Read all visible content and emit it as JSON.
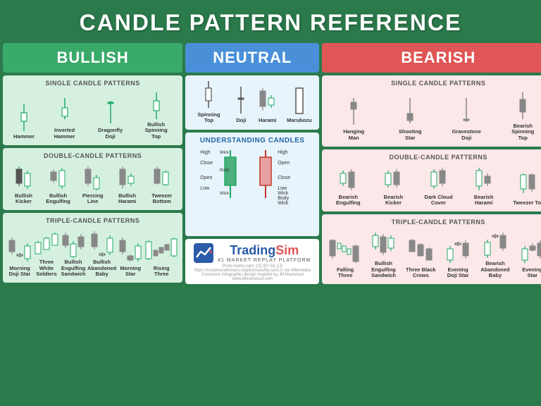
{
  "header": {
    "title": "CANDLE PATTERN REFERENCE"
  },
  "sections": {
    "bullish_label": "BULLISH",
    "neutral_label": "NEUTRAL",
    "bearish_label": "BEARISH"
  },
  "bullish_single": {
    "title": "SINGLE CANDLE PATTERNS",
    "patterns": [
      {
        "label": "Hammer"
      },
      {
        "label": "Inverted Hammer"
      },
      {
        "label": "Dragonfly Doji"
      },
      {
        "label": "Bullish Spinning Top"
      }
    ]
  },
  "bullish_double": {
    "title": "DOUBLE-CANDLE PATTERNS",
    "patterns": [
      {
        "label": "Bullish Kicker"
      },
      {
        "label": "Bullish Engulfing"
      },
      {
        "label": "Piercing Line"
      },
      {
        "label": "Bullish Harami"
      },
      {
        "label": "Tweezer Bottom"
      }
    ]
  },
  "bullish_triple": {
    "title": "TRIPLE-CANDLE PATTERNS",
    "patterns": [
      {
        "label": "Morning Doji Star"
      },
      {
        "label": "Three White Soldiers"
      },
      {
        "label": "Bullish Engulfing Sandwich"
      },
      {
        "label": "Bullish Abandoned Baby"
      },
      {
        "label": "Morning Star"
      },
      {
        "label": "Rising Three"
      }
    ]
  },
  "neutral_single": {
    "patterns": [
      {
        "label": "Spinning Top"
      },
      {
        "label": "Doji"
      },
      {
        "label": "Harami"
      },
      {
        "label": "Marubozu"
      }
    ]
  },
  "understanding": {
    "title": "UNDERSTANDING CANDLES",
    "labels": [
      "Wick",
      "Body",
      "Wick",
      "High",
      "Close",
      "Open",
      "Low",
      "High",
      "Open",
      "Close",
      "Low",
      "Wick",
      "Body",
      "Wick"
    ]
  },
  "bearish_single": {
    "title": "SINGLE CANDLE PATTERNS",
    "patterns": [
      {
        "label": "Hanging Man"
      },
      {
        "label": "Shooting Star"
      },
      {
        "label": "Gravestone Doji"
      },
      {
        "label": "Bearish Spinning Top"
      }
    ]
  },
  "bearish_double": {
    "title": "DOUBLE-CANDLE PATTERNS",
    "patterns": [
      {
        "label": "Bearish Engulfing"
      },
      {
        "label": "Bearish Kicker"
      },
      {
        "label": "Dark Cloud Cover"
      },
      {
        "label": "Bearish Harami"
      },
      {
        "label": "Tweezer Top"
      }
    ]
  },
  "bearish_triple": {
    "title": "TRIPLE-CANDLE PATTERNS",
    "patterns": [
      {
        "label": "Falling Three"
      },
      {
        "label": "Bullish Engulfing Sandwich"
      },
      {
        "label": "Three Black Crows"
      },
      {
        "label": "Evening Doji Star"
      },
      {
        "label": "Bearish Abandoned Baby"
      },
      {
        "label": "Evening Star"
      }
    ]
  },
  "footer": {
    "logo_name": "TradingSim",
    "logo_accent": "Sim",
    "tagline": "#1 MARKET REPLAY PLATFORM",
    "credit": "Proto-metro.com, CC BY-SA 3.0 https://creativecommons.org/licenses/by-sa/3.0, via Wikimedia Commons    Infographic design inspired by Jill Manwood www.jillmarwood.com"
  }
}
